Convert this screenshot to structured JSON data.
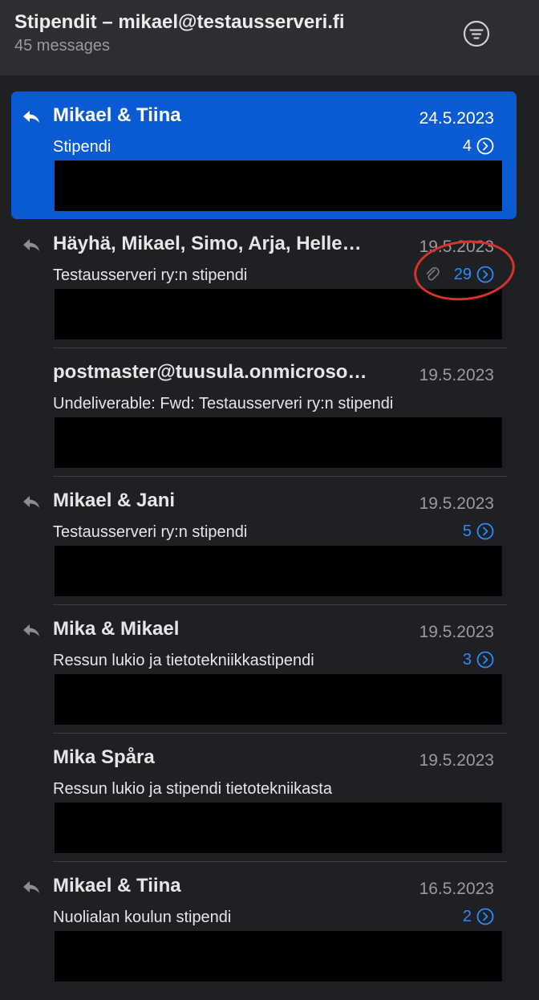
{
  "header": {
    "mailbox_title": "Stipendit – mikael@testausserveri.fi",
    "message_count": "45 messages",
    "filter_icon": "filter-lines-icon"
  },
  "colors": {
    "background": "#1f2023",
    "header_background": "#2d2e31",
    "selected_background": "#0a5bd3",
    "accent_blue": "#2a8bff",
    "secondary_text": "#9a9a9c",
    "annotation_red": "#d8332a"
  },
  "messages": [
    {
      "sender": "Mikael & Tiina",
      "date": "24.5.2023",
      "subject": "Stipendi",
      "thread_count": "4",
      "replied": true,
      "selected": true,
      "attachment": false
    },
    {
      "sender": "Häyhä, Mikael, Simo, Arja, Helle…",
      "date": "19.5.2023",
      "subject": "Testausserveri ry:n stipendi",
      "thread_count": "29",
      "replied": true,
      "selected": false,
      "attachment": true
    },
    {
      "sender": "postmaster@tuusula.onmicroso…",
      "date": "19.5.2023",
      "subject": "Undeliverable: Fwd: Testausserveri ry:n stipendi",
      "thread_count": "",
      "replied": false,
      "selected": false,
      "attachment": false
    },
    {
      "sender": "Mikael & Jani",
      "date": "19.5.2023",
      "subject": "Testausserveri ry:n stipendi",
      "thread_count": "5",
      "replied": true,
      "selected": false,
      "attachment": false
    },
    {
      "sender": "Mika & Mikael",
      "date": "19.5.2023",
      "subject": "Ressun lukio ja tietotekniikkastipendi",
      "thread_count": "3",
      "replied": true,
      "selected": false,
      "attachment": false
    },
    {
      "sender": "Mika Spåra",
      "date": "19.5.2023",
      "subject": "Ressun lukio ja stipendi tietotekniikasta",
      "thread_count": "",
      "replied": false,
      "selected": false,
      "attachment": false
    },
    {
      "sender": "Mikael & Tiina",
      "date": "16.5.2023",
      "subject": "Nuolialan koulun stipendi",
      "thread_count": "2",
      "replied": true,
      "selected": false,
      "attachment": false
    }
  ]
}
